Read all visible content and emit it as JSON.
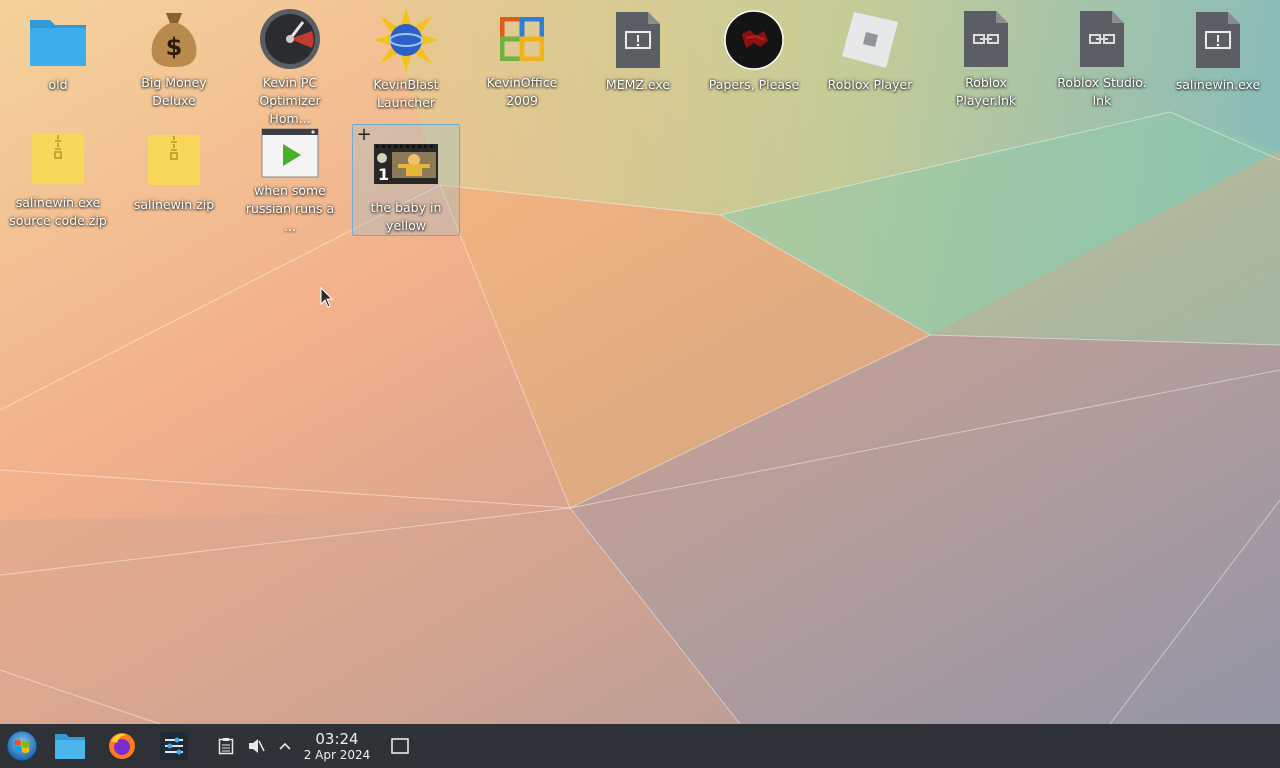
{
  "desktop": {
    "icons": [
      {
        "label": "old",
        "icon": "folder-icon"
      },
      {
        "label": "Big Money Deluxe",
        "icon": "money-bag-icon"
      },
      {
        "label": "Kevin PC Optimizer Hom...",
        "icon": "speedometer-icon"
      },
      {
        "label": "KevinBlast Launcher",
        "icon": "sunburst-globe-icon"
      },
      {
        "label": "KevinOffice 2009",
        "icon": "office-logo-icon"
      },
      {
        "label": "MEMZ.exe",
        "icon": "executable-file-icon"
      },
      {
        "label": "Papers, Please",
        "icon": "papers-please-icon"
      },
      {
        "label": "Roblox Player",
        "icon": "roblox-icon"
      },
      {
        "label": "Roblox Player.lnk",
        "icon": "link-file-icon"
      },
      {
        "label": "Roblox Studio.\nlnk",
        "icon": "link-file-icon"
      },
      {
        "label": "salinewin.exe",
        "icon": "executable-file-icon"
      },
      {
        "label": "salinewin.exe source code.zip",
        "icon": "zip-archive-icon"
      },
      {
        "label": "salinewin.zip",
        "icon": "zip-archive-icon"
      },
      {
        "label": "when some russian runs a ...",
        "icon": "video-file-icon"
      },
      {
        "label": "the baby in yellow",
        "icon": "video-thumbnail-icon",
        "selected": true
      }
    ]
  },
  "taskbar": {
    "launchers": [
      "start-menu-icon",
      "file-manager-icon",
      "firefox-icon",
      "system-settings-icon"
    ],
    "tray": [
      "clipboard-icon",
      "volume-muted-icon",
      "show-hidden-icons-chevron"
    ],
    "clock": {
      "time": "03:24",
      "date": "2 Apr 2024"
    },
    "show_desktop": "show-desktop-icon"
  },
  "colors": {
    "taskbar_bg": "#2e3136",
    "folder_blue": "#3daee9",
    "zip_yellow": "#f7d85a"
  }
}
